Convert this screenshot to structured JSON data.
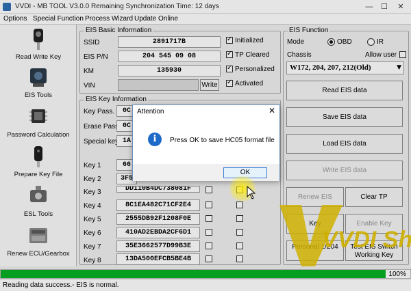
{
  "window": {
    "title": "VVDI - MB TOOL V3.0.0    Remaining Synchronization Time: 12 days",
    "minimize": "—",
    "maximize": "☐",
    "close": "✕"
  },
  "menu": [
    "Options",
    "Special Function",
    "Process Wizard",
    "Update Online"
  ],
  "sidebar": {
    "items": [
      {
        "label": "Read Write Key",
        "icon": "key-icon"
      },
      {
        "label": "EIS Tools",
        "icon": "eis-module-icon"
      },
      {
        "label": "Password Calculation",
        "icon": "chip-icon"
      },
      {
        "label": "Prepare Key File",
        "icon": "key-fob-icon"
      },
      {
        "label": "ESL Tools",
        "icon": "esl-lock-icon"
      },
      {
        "label": "Renew ECU/Gearbox",
        "icon": "ecu-icon"
      }
    ]
  },
  "eis_basic": {
    "legend": "EIS Basic Information",
    "ssid_label": "SSID",
    "ssid": "2891717B",
    "eisp_label": "EIS P/N",
    "eisp": "204 545 09 08",
    "km_label": "KM",
    "km": "135930",
    "vin_label": "VIN",
    "vin": "",
    "write_button": "Write",
    "checks": [
      {
        "label": "Initialized",
        "checked": true
      },
      {
        "label": "TP Cleared",
        "checked": true
      },
      {
        "label": "Personalized",
        "checked": true
      },
      {
        "label": "Activated",
        "checked": true
      }
    ]
  },
  "eis_key": {
    "legend": "EIS Key Information",
    "keypass_label": "Key Pass.",
    "keypass": "0C",
    "erase_label": "Erase Pass.",
    "erase": "0C",
    "special_label": "Special key",
    "special": "1A",
    "keys": [
      {
        "label": "Key 1",
        "value": "66",
        "c1": false,
        "c2": false
      },
      {
        "label": "Key 2",
        "value": "3F5",
        "c1": false,
        "c2": false
      },
      {
        "label": "Key 3",
        "value": "DD110B4DC738081F",
        "c1": false,
        "c2": false
      },
      {
        "label": "Key 4",
        "value": "8C1EA482C71CF2E4",
        "c1": false,
        "c2": false
      },
      {
        "label": "Key 5",
        "value": "2555DB92F1208F0E",
        "c1": false,
        "c2": false
      },
      {
        "label": "Key 6",
        "value": "410AD2EBDA2CF6D1",
        "c1": false,
        "c2": false
      },
      {
        "label": "Key 7",
        "value": "35E3662577D99B3E",
        "c1": false,
        "c2": false
      },
      {
        "label": "Key 8",
        "value": "13DA500EFCB5BE4B",
        "c1": false,
        "c2": false
      }
    ]
  },
  "eis_function": {
    "legend": "EIS Function",
    "mode_label": "Mode",
    "mode_obd": "OBD",
    "mode_ir": "IR",
    "mode_selected": "OBD",
    "chassis_label": "Chassis",
    "allow_user": "Allow user",
    "chassis_value": "W172, 204, 207, 212(Old)",
    "buttons": {
      "read": "Read EIS data",
      "save": "Save EIS data",
      "load": "Load EIS data",
      "write": "Write EIS data",
      "renew": "Renew EIS",
      "clear_tp": "Clear TP",
      "key": "Key",
      "enable_key": "Enable Key",
      "personal": "Personal 1/204",
      "test": "Test EIS Switch Working Key"
    }
  },
  "progress": {
    "percent_label": "100%",
    "value": 1.0
  },
  "status": {
    "text": "Reading data success.- EIS is normal."
  },
  "dialog": {
    "title": "Attention",
    "close": "✕",
    "icon": "info-icon",
    "icon_glyph": "i",
    "message": "Press OK to save HC05 format file",
    "ok": "OK"
  },
  "watermark": {
    "text": "VVDI Shop"
  },
  "colors": {
    "progress": "#06b025",
    "accent": "#1e6ac9",
    "watermark": "#e6c400"
  }
}
